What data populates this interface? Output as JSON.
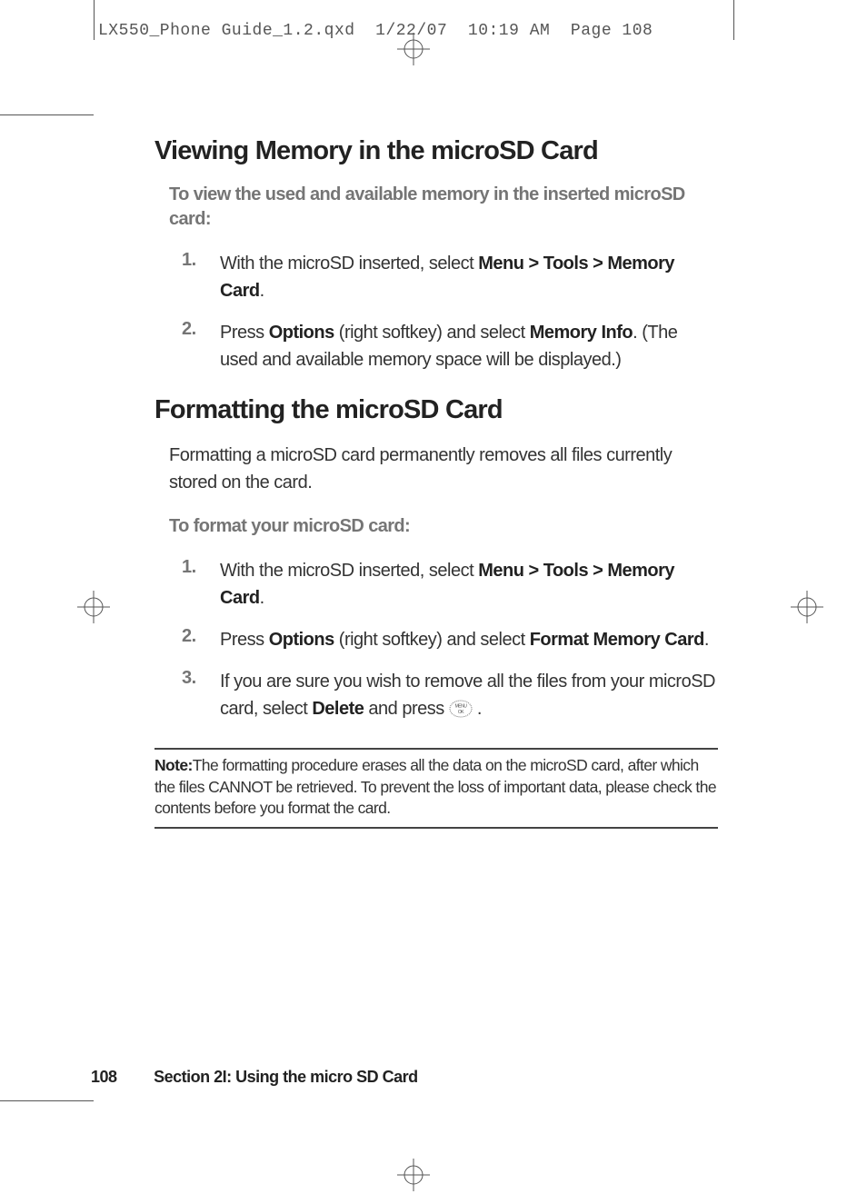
{
  "header": {
    "filename": "LX550_Phone Guide_1.2.qxd",
    "date": "1/22/07",
    "time": "10:19 AM",
    "page_label": "Page 108"
  },
  "section1": {
    "heading": "Viewing Memory in the microSD Card",
    "sub": "To view the used and available memory in the inserted microSD card:",
    "steps": [
      {
        "num": "1.",
        "pre": "With the microSD inserted, select ",
        "bold": "Menu > Tools > Memory Card",
        "post": "."
      },
      {
        "num": "2.",
        "pre": "Press ",
        "bold1": "Options",
        "mid": " (right softkey) and select ",
        "bold2": "Memory Info",
        "post": ". (The used and available memory space will be displayed.)"
      }
    ]
  },
  "section2": {
    "heading": "Formatting the microSD Card",
    "para": "Formatting a microSD card permanently removes all files currently stored on the card.",
    "sub": "To format your microSD card:",
    "steps": [
      {
        "num": "1.",
        "pre": "With the microSD inserted, select ",
        "bold": "Menu > Tools > Memory Card",
        "post": "."
      },
      {
        "num": "2.",
        "pre": "Press ",
        "bold1": "Options",
        "mid": " (right softkey) and select ",
        "bold2": "Format Memory Card",
        "post": "."
      },
      {
        "num": "3.",
        "pre": "If you are sure you wish to remove all the files from your microSD card, select ",
        "bold": "Delete",
        "mid": " and press ",
        "post": " ."
      }
    ]
  },
  "note": {
    "label": "Note:",
    "text": "The formatting procedure erases all the data on the microSD card, after which the files CANNOT be retrieved. To prevent the loss of important data, please check the contents before you format the card."
  },
  "footer": {
    "page_number": "108",
    "section": "Section 2I: Using the micro SD Card"
  }
}
